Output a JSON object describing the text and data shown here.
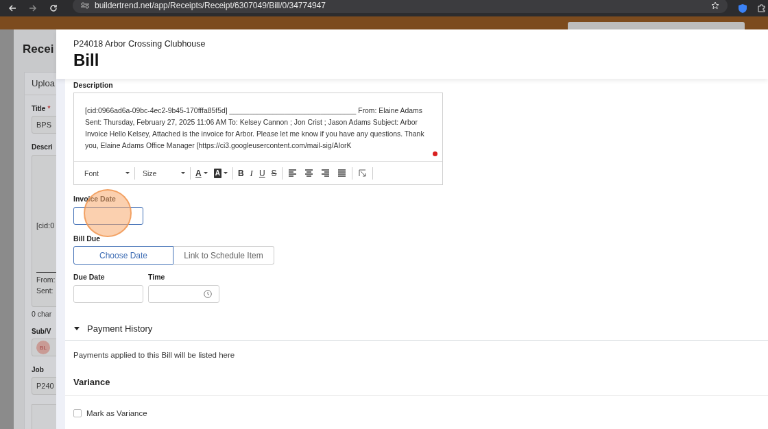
{
  "browser": {
    "url": "buildertrend.net/app/Receipts/Receipt/6307049/Bill/0/34774947"
  },
  "background_page": {
    "title": "Recei",
    "section": "Uploa",
    "title_label": "Title",
    "required_mark": "*",
    "title_value": "BPS",
    "description_label": "Descri",
    "description_lines": [
      "[cid:0",
      "From:",
      "Sent:"
    ],
    "char_count": "0 char",
    "vendor_label": "Sub/V",
    "vendor_avatar": "BL",
    "job_label": "Job",
    "job_value": "P240"
  },
  "modal": {
    "job": "P24018 Arbor Crossing Clubhouse",
    "title": "Bill",
    "description": {
      "label": "Description",
      "text": "[cid:0966ad6a-09bc-4ec2-9b45-170fffa85f5d] ________________________________ From: Elaine Adams Sent: Thursday, February 27, 2025 11:06 AM To: Kelsey Cannon ; Jon Crist ; Jason Adams Subject: Arbor Invoice Hello Kelsey, Attached is the invoice for Arbor. Please let me know if you have any questions. Thank you, Elaine Adams Office Manager [https://ci3.googleusercontent.com/mail-sig/AIorK",
      "toolbar_groups": [
        [
          {
            "kind": "select",
            "label": "Font"
          }
        ],
        [
          {
            "kind": "select",
            "label": "Size"
          }
        ],
        [
          {
            "kind": "text-color",
            "label": "A"
          },
          {
            "kind": "highlight",
            "label": "A"
          }
        ],
        [
          {
            "kind": "bold",
            "label": "B"
          },
          {
            "kind": "italic",
            "label": "I"
          },
          {
            "kind": "underline",
            "label": "U"
          },
          {
            "kind": "strike",
            "label": "S"
          }
        ],
        [
          {
            "kind": "align-left"
          },
          {
            "kind": "align-center"
          },
          {
            "kind": "align-right"
          },
          {
            "kind": "justify"
          }
        ],
        [
          {
            "kind": "resize"
          }
        ]
      ]
    },
    "invoice_date": {
      "label": "Invoice Date",
      "focused": true
    },
    "bill_due": {
      "label": "Bill Due",
      "options": [
        {
          "label": "Choose Date",
          "selected": true
        },
        {
          "label": "Link to Schedule Item",
          "selected": false
        }
      ]
    },
    "due_date": {
      "label": "Due Date"
    },
    "time": {
      "label": "Time"
    },
    "payment_history": {
      "title": "Payment History",
      "expanded": true,
      "message": "Payments applied to this Bill will be listed here"
    },
    "variance": {
      "title": "Variance",
      "checkbox": {
        "label": "Mark as Variance",
        "checked": false
      }
    }
  }
}
